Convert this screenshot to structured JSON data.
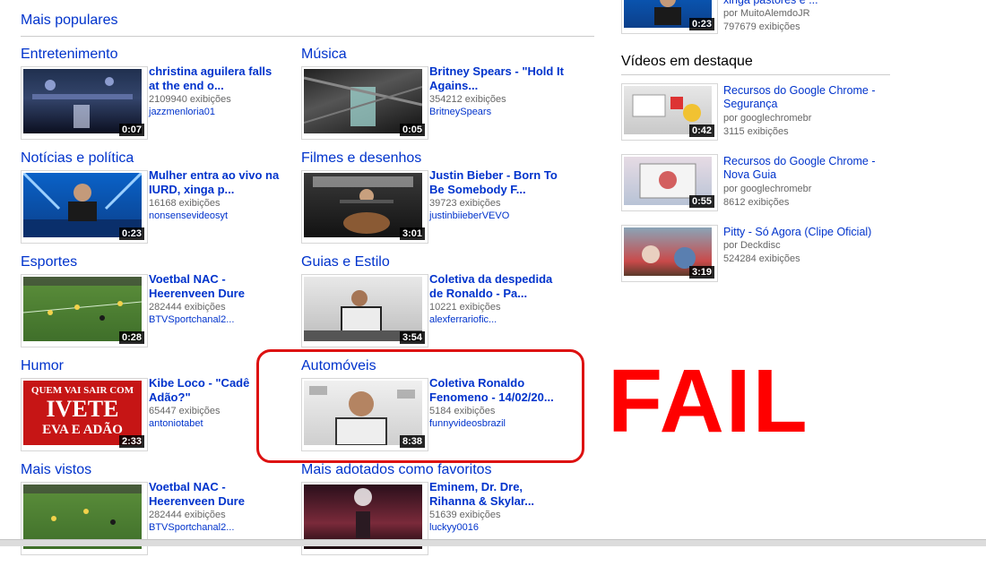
{
  "section_title": "Mais populares",
  "categories": [
    {
      "name": "Entretenimento",
      "title": "christina aguilera falls at the end o...",
      "views": "2109940 exibições",
      "user": "jazzmenloria01",
      "duration": "0:07"
    },
    {
      "name": "Música",
      "title": "Britney Spears - \"Hold It Agains...",
      "views": "354212 exibições",
      "user": "BritneySpears",
      "duration": "0:05"
    },
    {
      "name": "Notícias e política",
      "title": "Mulher entra ao vivo na IURD, xinga p...",
      "views": "16168 exibições",
      "user": "nonsensevideosyt",
      "duration": "0:23"
    },
    {
      "name": "Filmes e desenhos",
      "title": "Justin Bieber - Born To Be Somebody F...",
      "views": "39723 exibições",
      "user": "justinbiieberVEVO",
      "duration": "3:01"
    },
    {
      "name": "Esportes",
      "title": "Voetbal NAC - Heerenveen Dure",
      "views": "282444 exibições",
      "user": "BTVSportchanal2...",
      "duration": "0:28"
    },
    {
      "name": "Guias e Estilo",
      "title": "Coletiva da despedida de Ronaldo - Pa...",
      "views": "10221 exibições",
      "user": "alexferrariofic...",
      "duration": "3:54"
    },
    {
      "name": "Humor",
      "title": "Kibe Loco - \"Cadê Adão?\"",
      "views": "65447 exibições",
      "user": "antoniotabet",
      "duration": "2:33",
      "thumb_text": [
        "QUEM VAI SAIR COM",
        "IVETE",
        "EVA E ADÃO"
      ]
    },
    {
      "name": "Automóveis",
      "title": "Coletiva Ronaldo Fenomeno - 14/02/20...",
      "views": "5184 exibições",
      "user": "funnyvideosbrazil",
      "duration": "8:38"
    },
    {
      "name": "Mais vistos",
      "title": "Voetbal NAC - Heerenveen Dure",
      "views": "282444 exibições",
      "user": "BTVSportchanal2...",
      "duration": ""
    },
    {
      "name": "Mais adotados como favoritos",
      "title": "Eminem, Dr. Dre, Rihanna & Skylar...",
      "views": "51639 exibições",
      "user": "luckyy0016",
      "duration": ""
    }
  ],
  "side": {
    "top_item": {
      "title": "xinga pastores e ...",
      "by": "por MuitoAlemdoJR",
      "views": "797679 exibições",
      "duration": "0:23"
    },
    "featured_heading": "Vídeos em destaque",
    "featured": [
      {
        "title": "Recursos do Google Chrome - Segurança",
        "by": "por googlechromebr",
        "views": "3115 exibições",
        "duration": "0:42"
      },
      {
        "title": "Recursos do Google Chrome - Nova Guia",
        "by": "por googlechromebr",
        "views": "8612 exibições",
        "duration": "0:55"
      },
      {
        "title": "Pitty - Só Agora (Clipe Oficial)",
        "by": "por Deckdisc",
        "views": "524284 exibições",
        "duration": "3:19"
      }
    ]
  },
  "annotation": {
    "text": "FAIL",
    "color": "#ff0000"
  },
  "colors": {
    "link": "#0033cc",
    "meta": "#666666",
    "highlight": "#dd1111"
  }
}
